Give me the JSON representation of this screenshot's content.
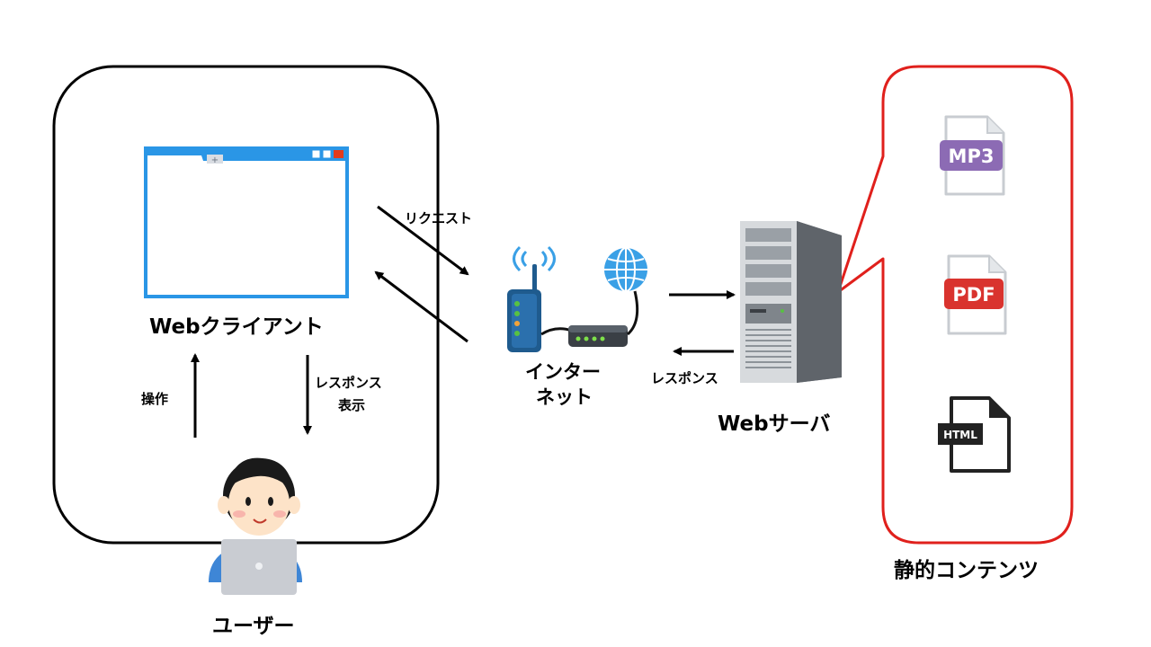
{
  "labels": {
    "web_client": "Webクライアント",
    "user": "ユーザー",
    "operation": "操作",
    "response_display_line1": "レスポンス",
    "response_display_line2": "表示",
    "request": "リクエスト",
    "internet_line1": "インター",
    "internet_line2": "ネット",
    "response": "レスポンス",
    "web_server": "Webサーバ",
    "static_contents": "静的コンテンツ"
  },
  "files": {
    "mp3": "MP3",
    "pdf": "PDF",
    "html": "HTML"
  },
  "colors": {
    "client_box_border": "#000000",
    "static_box_border": "#e0201c",
    "browser_frame": "#2a96e6",
    "browser_close": "#e23b1d",
    "mp3_badge": "#8c6bb4",
    "pdf_badge": "#d9332e",
    "html_icon": "#222222",
    "router_body": "#1f5b8e",
    "globe": "#3aa0e6",
    "skin": "#fde3c8",
    "hair": "#1a1a1a",
    "shirt": "#3e86d6",
    "laptop": "#c9ccd2"
  }
}
